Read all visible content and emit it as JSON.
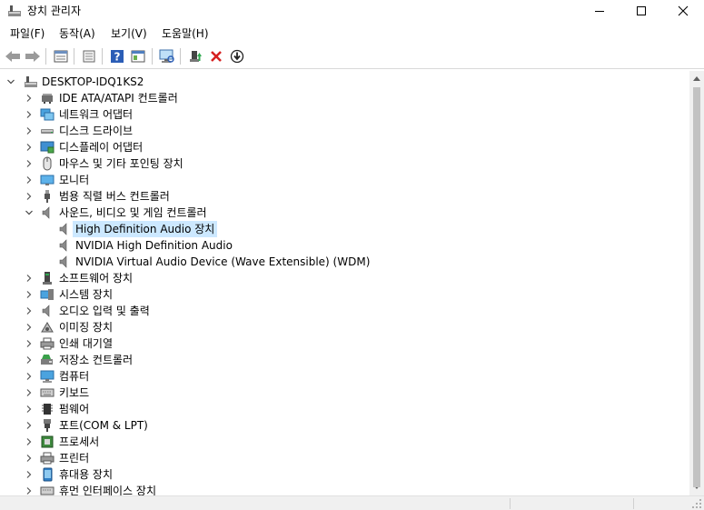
{
  "window": {
    "title": "장치 관리자",
    "minimize_icon": "minimize-icon",
    "maximize_icon": "maximize-icon",
    "close_icon": "close-icon"
  },
  "menu": [
    {
      "label": "파일(F)"
    },
    {
      "label": "동작(A)"
    },
    {
      "label": "보기(V)"
    },
    {
      "label": "도움말(H)"
    }
  ],
  "toolbar": [
    {
      "icon": "back-arrow-icon"
    },
    {
      "icon": "forward-arrow-icon"
    },
    {
      "icon": "properties-icon"
    },
    {
      "icon": "properties-sheet-icon"
    },
    {
      "icon": "help-icon"
    },
    {
      "icon": "show-hidden-icon"
    },
    {
      "icon": "scan-hardware-icon"
    },
    {
      "icon": "update-driver-icon"
    },
    {
      "icon": "uninstall-device-icon"
    },
    {
      "icon": "disable-device-icon"
    }
  ],
  "tree": {
    "root": "DESKTOP-IDQ1KS2",
    "categories": [
      {
        "label": "IDE ATA/ATAPI 컨트롤러",
        "icon": "ide-controller-icon"
      },
      {
        "label": "네트워크 어댑터",
        "icon": "network-adapter-icon"
      },
      {
        "label": "디스크 드라이브",
        "icon": "disk-drive-icon"
      },
      {
        "label": "디스플레이 어댑터",
        "icon": "display-adapter-icon"
      },
      {
        "label": "마우스 및 기타 포인팅 장치",
        "icon": "mouse-icon"
      },
      {
        "label": "모니터",
        "icon": "monitor-icon"
      },
      {
        "label": "범용 직렬 버스 컨트롤러",
        "icon": "usb-icon"
      },
      {
        "label": "사운드, 비디오 및 게임 컨트롤러",
        "icon": "speaker-icon",
        "expanded": true,
        "children": [
          {
            "label": "High Definition Audio 장치",
            "selected": true
          },
          {
            "label": "NVIDIA High Definition Audio"
          },
          {
            "label": "NVIDIA Virtual Audio Device (Wave Extensible) (WDM)"
          }
        ]
      },
      {
        "label": "소프트웨어 장치",
        "icon": "software-device-icon"
      },
      {
        "label": "시스템 장치",
        "icon": "system-device-icon"
      },
      {
        "label": "오디오 입력 및 출력",
        "icon": "audio-io-icon"
      },
      {
        "label": "이미징 장치",
        "icon": "imaging-device-icon"
      },
      {
        "label": "인쇄 대기열",
        "icon": "print-queue-icon"
      },
      {
        "label": "저장소 컨트롤러",
        "icon": "storage-controller-icon"
      },
      {
        "label": "컴퓨터",
        "icon": "computer-icon"
      },
      {
        "label": "키보드",
        "icon": "keyboard-icon"
      },
      {
        "label": "펌웨어",
        "icon": "firmware-icon"
      },
      {
        "label": "포트(COM & LPT)",
        "icon": "port-icon"
      },
      {
        "label": "프로세서",
        "icon": "processor-icon"
      },
      {
        "label": "프린터",
        "icon": "printer-icon"
      },
      {
        "label": "휴대용 장치",
        "icon": "portable-device-icon"
      },
      {
        "label": "휴먼 인터페이스 장치",
        "icon": "hid-icon"
      }
    ]
  }
}
